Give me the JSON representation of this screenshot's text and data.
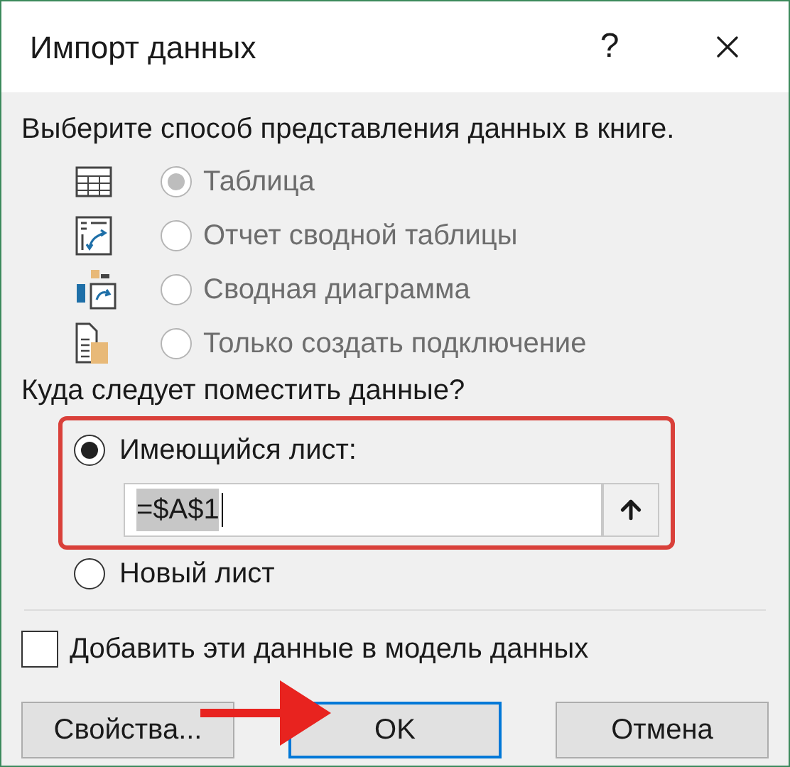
{
  "window": {
    "title": "Импорт данных",
    "help": "?"
  },
  "view": {
    "heading": "Выберите способ представления данных в книге.",
    "options": [
      {
        "kind": "table",
        "label": "Таблица",
        "selected": true,
        "disabled": true
      },
      {
        "kind": "pivot",
        "label": "Отчет сводной таблицы",
        "selected": false,
        "disabled": true
      },
      {
        "kind": "chart",
        "label": "Сводная диаграмма",
        "selected": false,
        "disabled": true
      },
      {
        "kind": "connection",
        "label": "Только создать подключение",
        "selected": false,
        "disabled": true
      }
    ]
  },
  "destination": {
    "heading": "Куда следует поместить данные?",
    "existing": {
      "label": "Имеющийся лист:",
      "selected": true,
      "highlighted": true
    },
    "range": {
      "value": "=$A$1",
      "selected_text": true
    },
    "new": {
      "label": "Новый лист",
      "selected": false
    }
  },
  "data_model": {
    "label": "Добавить эти данные в модель данных",
    "checked": false
  },
  "buttons": [
    {
      "label": "Свойства...",
      "default": false
    },
    {
      "label": "OK",
      "default": true
    },
    {
      "label": "Отмена",
      "default": false
    }
  ],
  "annotation": {
    "arrow": true
  }
}
